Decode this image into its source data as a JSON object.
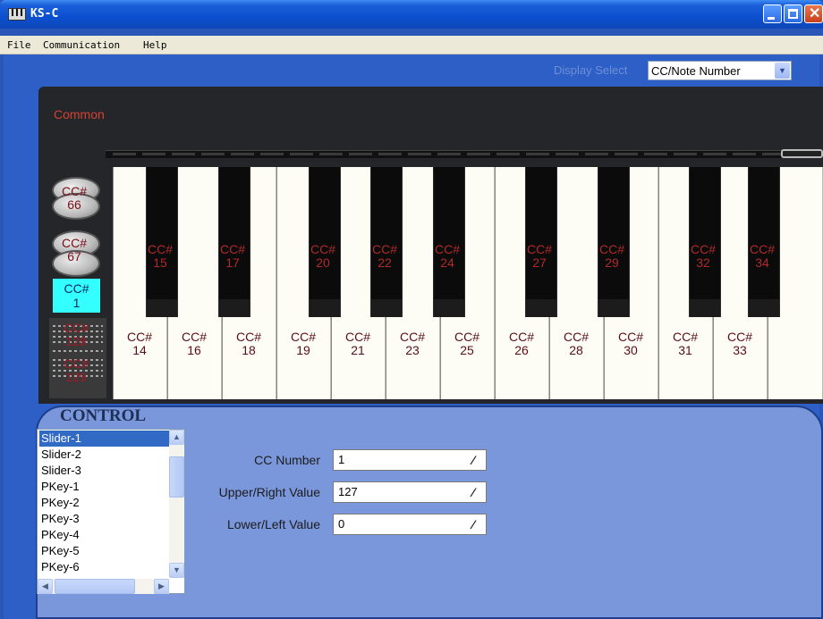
{
  "window": {
    "title": "KS-C"
  },
  "menu": {
    "items": [
      "File",
      "Communication",
      "Help"
    ]
  },
  "display_select": {
    "label": "Display Select",
    "value": "CC/Note Number"
  },
  "keyboard": {
    "section_label": "Common",
    "white_keys": [
      {
        "cc": "CC#",
        "num": "14"
      },
      {
        "cc": "CC#",
        "num": "16"
      },
      {
        "cc": "CC#",
        "num": "18"
      },
      {
        "cc": "CC#",
        "num": "19"
      },
      {
        "cc": "CC#",
        "num": "21"
      },
      {
        "cc": "CC#",
        "num": "23"
      },
      {
        "cc": "CC#",
        "num": "25"
      },
      {
        "cc": "CC#",
        "num": "26"
      },
      {
        "cc": "CC#",
        "num": "28"
      },
      {
        "cc": "CC#",
        "num": "30"
      },
      {
        "cc": "CC#",
        "num": "31"
      },
      {
        "cc": "CC#",
        "num": "33"
      }
    ],
    "black_keys": [
      {
        "cc": "CC#",
        "num": "15"
      },
      {
        "cc": "CC#",
        "num": "17"
      },
      {
        "cc": "CC#",
        "num": "20"
      },
      {
        "cc": "CC#",
        "num": "22"
      },
      {
        "cc": "CC#",
        "num": "24"
      },
      {
        "cc": "CC#",
        "num": "27"
      },
      {
        "cc": "CC#",
        "num": "29"
      },
      {
        "cc": "CC#",
        "num": "32"
      },
      {
        "cc": "CC#",
        "num": "34"
      }
    ],
    "side": {
      "knob1": {
        "cc": "CC#",
        "num": "66"
      },
      "knob2": {
        "cc": "CC#",
        "num": "67"
      },
      "mod": {
        "cc": "CC#",
        "num": "1"
      },
      "pitch1": {
        "cc": "CC#",
        "num": "128"
      },
      "pitch2": {
        "cc": "CC#",
        "num": "129"
      }
    }
  },
  "control": {
    "title": "CONTROL",
    "list_items": [
      "Slider-1",
      "Slider-2",
      "Slider-3",
      "PKey-1",
      "PKey-2",
      "PKey-3",
      "PKey-4",
      "PKey-5",
      "PKey-6"
    ],
    "selected_item": "Slider-1",
    "fields": {
      "cc_number": {
        "label": "CC Number",
        "value": "1"
      },
      "upper_value": {
        "label": "Upper/Right Value",
        "value": "127"
      },
      "lower_value": {
        "label": "Lower/Left Value",
        "value": "0"
      }
    }
  },
  "colors": {
    "accent": "#316ac5",
    "control_bg": "#7b97dc",
    "highlight": "#33ffff"
  }
}
